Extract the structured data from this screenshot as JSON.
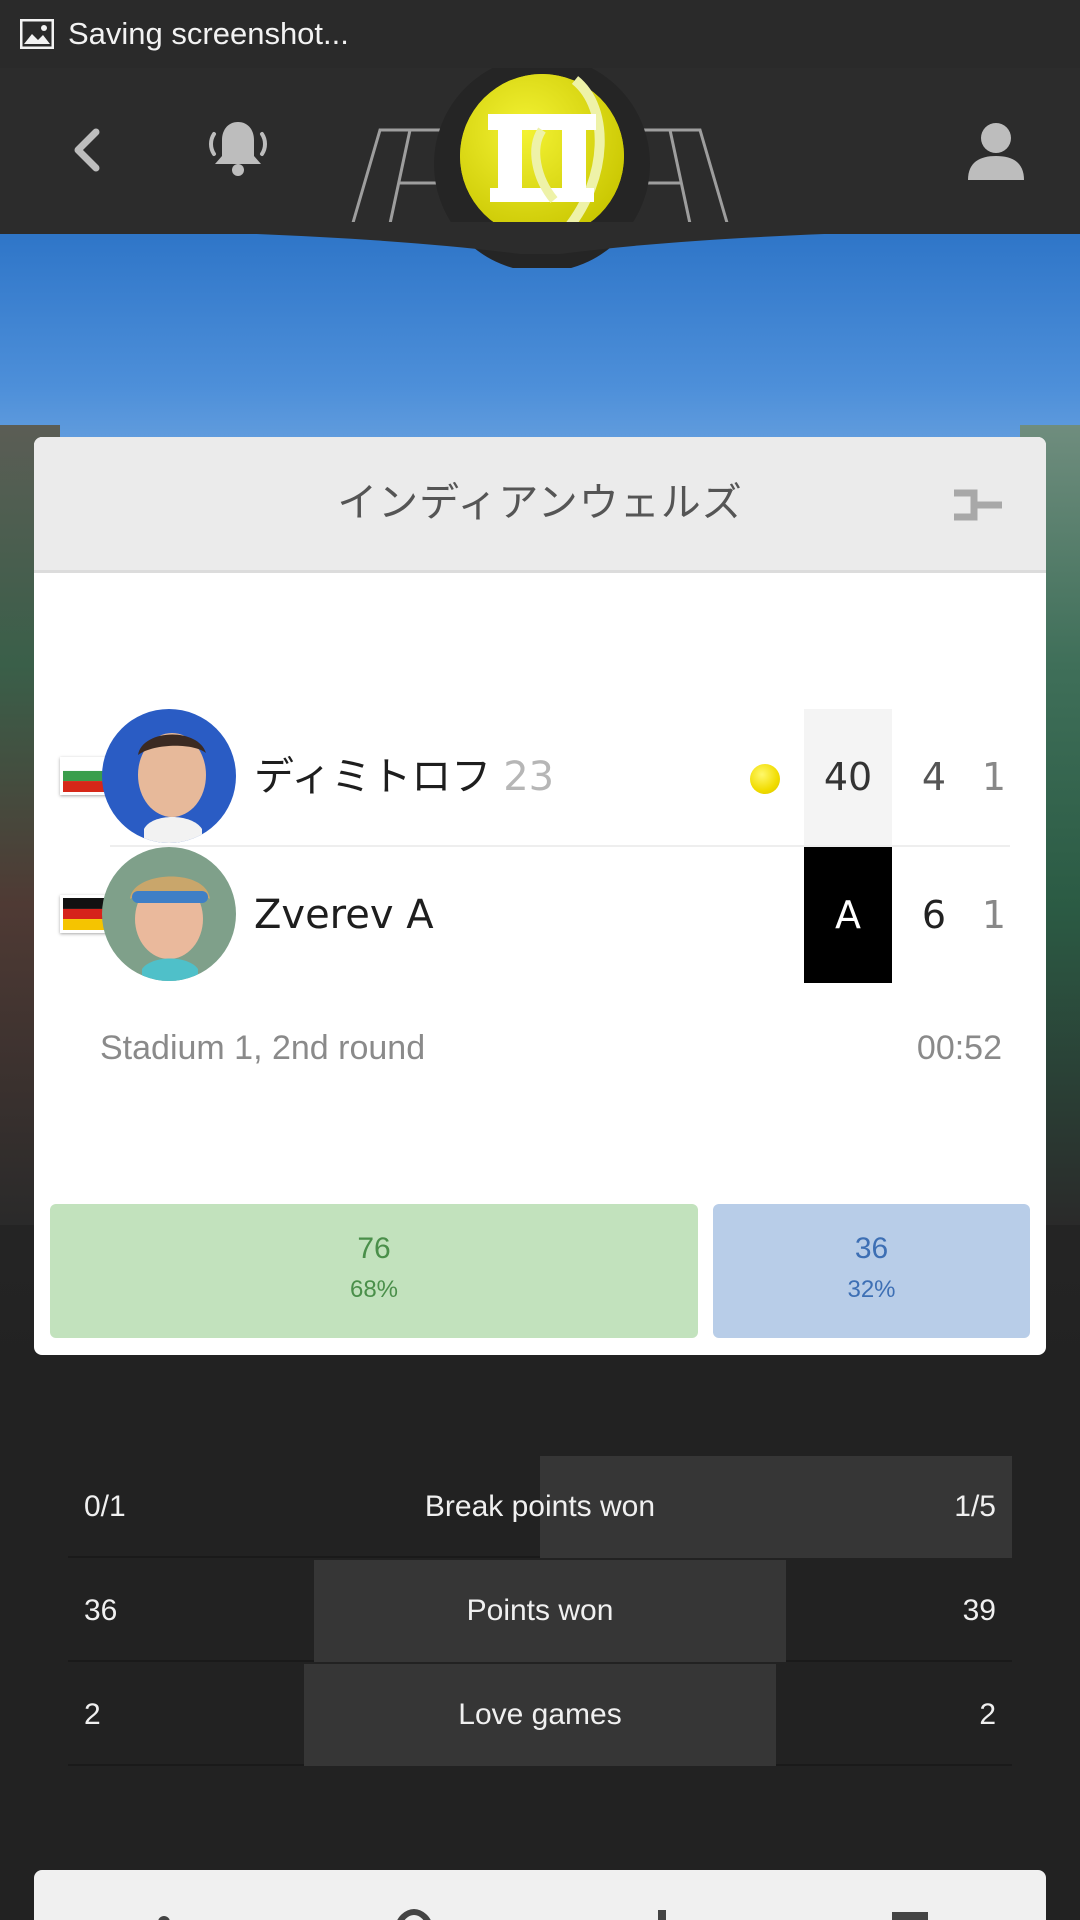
{
  "status_bar": {
    "text": "Saving screenshot..."
  },
  "tournament": {
    "name": "インディアンウェルズ"
  },
  "players": [
    {
      "name": "ディミトロフ",
      "seed": "23",
      "game_score": "40",
      "set2": "4",
      "set1": "1",
      "serving": true,
      "flag": "bulgaria"
    },
    {
      "name": "Zverev A",
      "seed": "",
      "game_score": "A",
      "set2": "6",
      "set1": "1",
      "serving": false,
      "flag": "germany"
    }
  ],
  "match_info": {
    "court": "Stadium 1, 2nd round",
    "duration": "00:52"
  },
  "votes": {
    "player1": {
      "count": "76",
      "percent": "68%"
    },
    "player2": {
      "count": "36",
      "percent": "32%"
    }
  },
  "stats": [
    {
      "label": "Break points won",
      "left": "0/1",
      "right": "1/5"
    },
    {
      "label": "Points won",
      "left": "36",
      "right": "39"
    },
    {
      "label": "Love games",
      "left": "2",
      "right": "2"
    }
  ],
  "icons": {
    "back": "chevron-left-icon",
    "notifications": "bell-ringing-icon",
    "logo": "tennis-ball-logo",
    "profile": "user-icon",
    "bracket": "bracket-icon",
    "status": "image-icon"
  },
  "colors": {
    "vote_p1_bg": "#c2e2bd",
    "vote_p2_bg": "#b8cde8",
    "serve_ball": "#f1dc00",
    "advantage_bg": "#000000"
  }
}
